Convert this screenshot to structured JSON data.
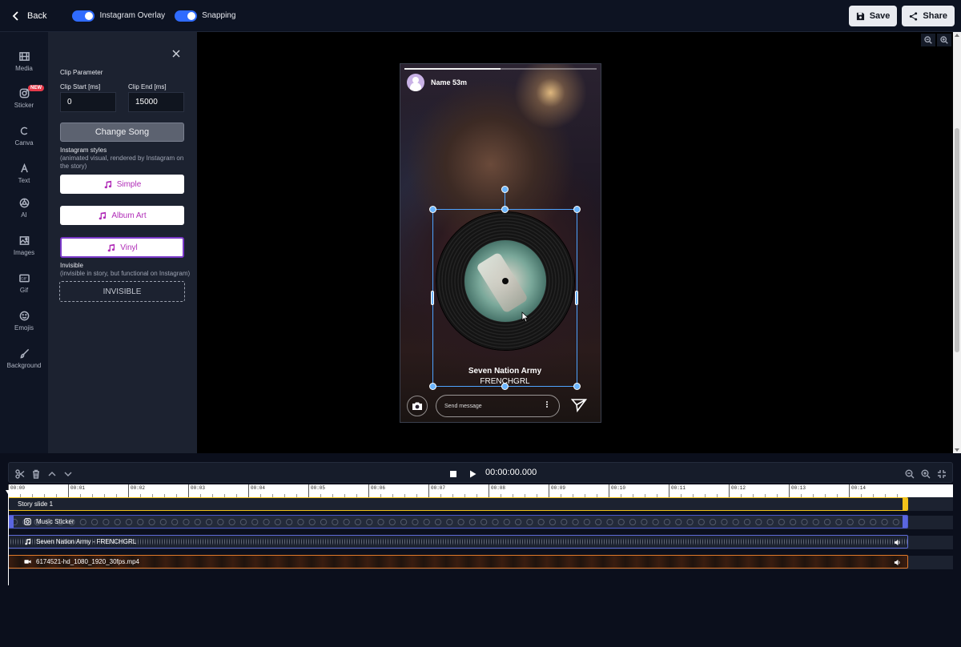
{
  "topbar": {
    "back_label": "Back",
    "overlay_toggle_label": "Instagram Overlay",
    "snapping_toggle_label": "Snapping",
    "save_label": "Save",
    "share_label": "Share"
  },
  "nav": {
    "items": [
      {
        "label": "Media",
        "icon": "film-icon"
      },
      {
        "label": "Sticker",
        "icon": "instagram-icon",
        "badge": "NEW"
      },
      {
        "label": "Canva",
        "icon": "canva-icon"
      },
      {
        "label": "Text",
        "icon": "text-icon"
      },
      {
        "label": "AI",
        "icon": "ai-icon"
      },
      {
        "label": "Images",
        "icon": "image-icon"
      },
      {
        "label": "Gif",
        "icon": "gif-icon"
      },
      {
        "label": "Emojis",
        "icon": "emoji-icon"
      },
      {
        "label": "Background",
        "icon": "brush-icon"
      }
    ]
  },
  "panel": {
    "title": "Clip Parameter",
    "clip_start_label": "Clip Start [ms]",
    "clip_start_value": "0",
    "clip_end_label": "Clip End [ms]",
    "clip_end_value": "15000",
    "change_song_label": "Change Song",
    "styles_title": "Instagram styles",
    "styles_desc": "(animated visual, rendered by Instagram on the story)",
    "style_buttons": [
      "Simple",
      "Album Art",
      "Vinyl"
    ],
    "selected_style": "Vinyl",
    "invisible_title": "Invisible",
    "invisible_desc": "(invisible in story, but functional on Instagram)",
    "invisible_button": "INVISIBLE"
  },
  "story": {
    "user_name": "Name 53m",
    "song_title": "Seven Nation Army",
    "song_artist": "FRENCHGRL",
    "message_placeholder": "Send message"
  },
  "timeline": {
    "time": "00:00:00.000",
    "ticks": [
      "|00:00",
      "|00:01",
      "|00:02",
      "|00:03",
      "|00:04",
      "|00:05",
      "|00:06",
      "|00:07",
      "|00:08",
      "|00:09",
      "|00:10",
      "|00:11",
      "|00:12",
      "|00:13",
      "|00:14"
    ],
    "tracks": [
      {
        "label": "Story slide 1",
        "kind": "story"
      },
      {
        "label": "Music Sticker",
        "kind": "sticker"
      },
      {
        "label": "Seven Nation Army - FRENCHGRL",
        "kind": "audio"
      },
      {
        "label": "6174521-hd_1080_1920_30fps.mp4",
        "kind": "video"
      }
    ]
  },
  "colors": {
    "accent": "#2f6bff",
    "story_track": "#f2c21a",
    "sticker_track": "#5a66e0",
    "video_track": "#e07a2a",
    "style_text": "#b02bb7"
  }
}
